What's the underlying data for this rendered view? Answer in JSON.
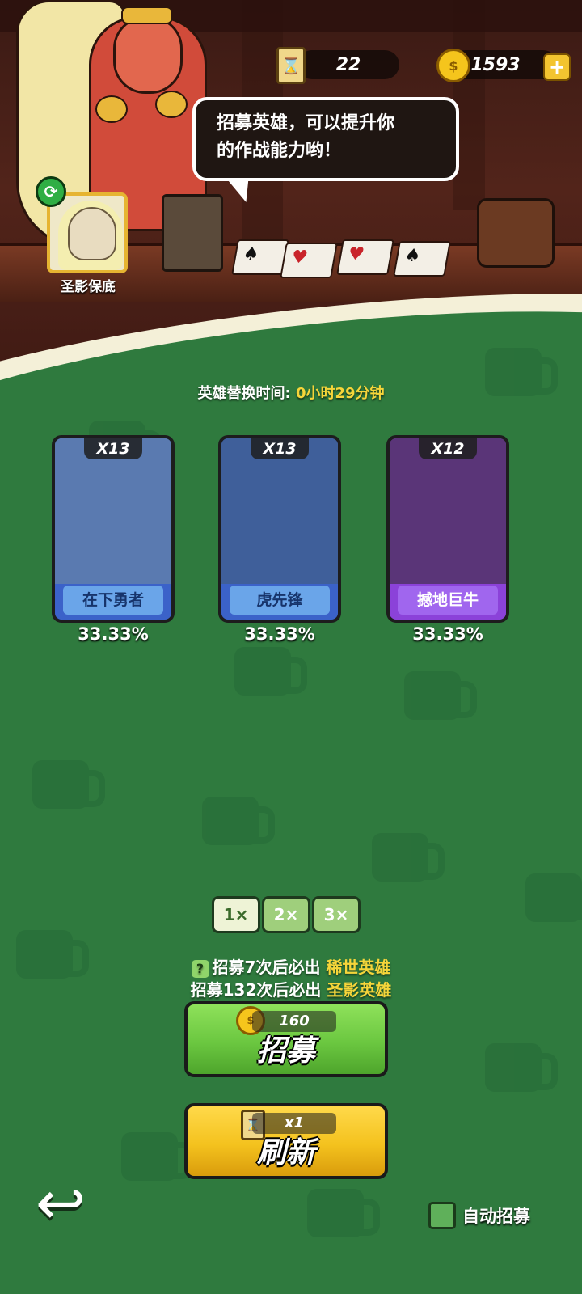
{
  "resources": {
    "scrolls": "22",
    "coins": "1593",
    "plus_label": "+"
  },
  "speech": {
    "line1": "招募英雄，可以提升你",
    "line2": "的作战能力哟！"
  },
  "pity_hero_label": "圣影保底",
  "timer": {
    "label": "英雄替换时间:",
    "value": "0小时29分钟"
  },
  "heroes": [
    {
      "count": "X13",
      "name": "在下勇者",
      "chance": "33.33%",
      "frame": "#3b62c9",
      "name_bg": "#6aa5e9",
      "name_color": "#17346b",
      "art_bg": "#5a7ab0"
    },
    {
      "count": "X13",
      "name": "虎先锋",
      "chance": "33.33%",
      "frame": "#3b62c9",
      "name_bg": "#6aa5e9",
      "name_color": "#17346b",
      "art_bg": "#3f5f9a"
    },
    {
      "count": "X12",
      "name": "撼地巨牛",
      "chance": "33.33%",
      "frame": "#8b42d9",
      "name_bg": "#a066ee",
      "name_color": "#ffffff",
      "art_bg": "#5a3578"
    }
  ],
  "multipliers": [
    {
      "label": "1×",
      "selected": true
    },
    {
      "label": "2×",
      "selected": false
    },
    {
      "label": "3×",
      "selected": false
    }
  ],
  "pity_info": {
    "q_icon": "?",
    "rare_prefix": "招募7次后必出",
    "rare_hl": "稀世英雄",
    "legend_prefix": "招募132次后必出",
    "legend_hl": "圣影英雄"
  },
  "recruit_button": {
    "cost": "160",
    "label": "招募",
    "cost_icon": "coin-icon"
  },
  "refresh_button": {
    "cost": "x1",
    "label": "刷新",
    "cost_icon": "hourglass-icon"
  },
  "auto_recruit_label": "自动招募",
  "colors": {
    "bg_green": "#2f7a3e",
    "gold_text": "#f5d53a",
    "recruit_green": "#7bd94f",
    "refresh_yellow": "#f4c92c"
  }
}
